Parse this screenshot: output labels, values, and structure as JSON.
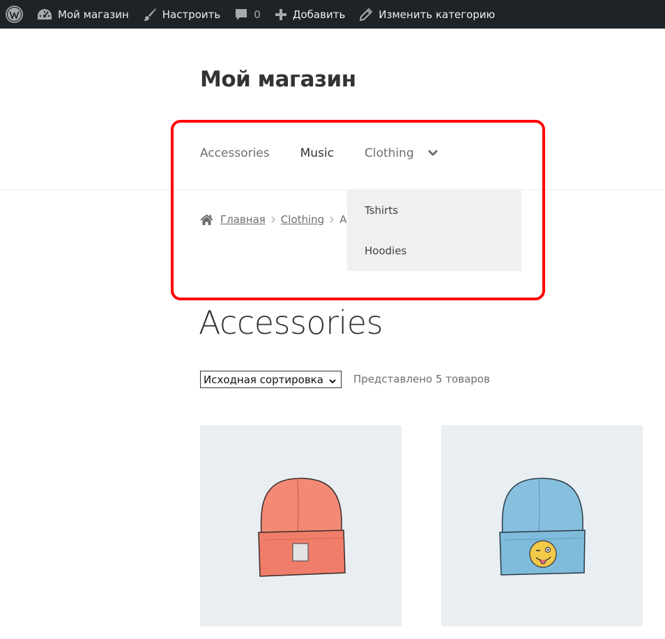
{
  "adminbar": {
    "site_name": "Мой магазин",
    "customize": "Настроить",
    "comments_count": "0",
    "add_new": "Добавить",
    "edit_category": "Изменить категорию"
  },
  "site": {
    "title": "Мой магазин"
  },
  "nav": {
    "items": [
      {
        "label": "Accessories"
      },
      {
        "label": "Music"
      },
      {
        "label": "Clothing"
      }
    ],
    "dropdown": [
      "Tshirts",
      "Hoodies"
    ]
  },
  "breadcrumb": {
    "home": "Главная",
    "clothing": "Clothing",
    "current": "Accessories"
  },
  "page": {
    "heading": "Accessories",
    "sort_value": "Исходная сортировка",
    "result_count": "Представлено 5 товаров"
  },
  "products": [
    {
      "icon": "orange-beanie-image",
      "color": "#f28a76"
    },
    {
      "icon": "blue-beanie-emoji-image",
      "color": "#86c0de"
    }
  ],
  "colors": {
    "adminbar": "#1d2327",
    "highlight": "#ff0000",
    "dropdown_bg": "#f0f0f0",
    "product_bg": "#e8eef2"
  }
}
